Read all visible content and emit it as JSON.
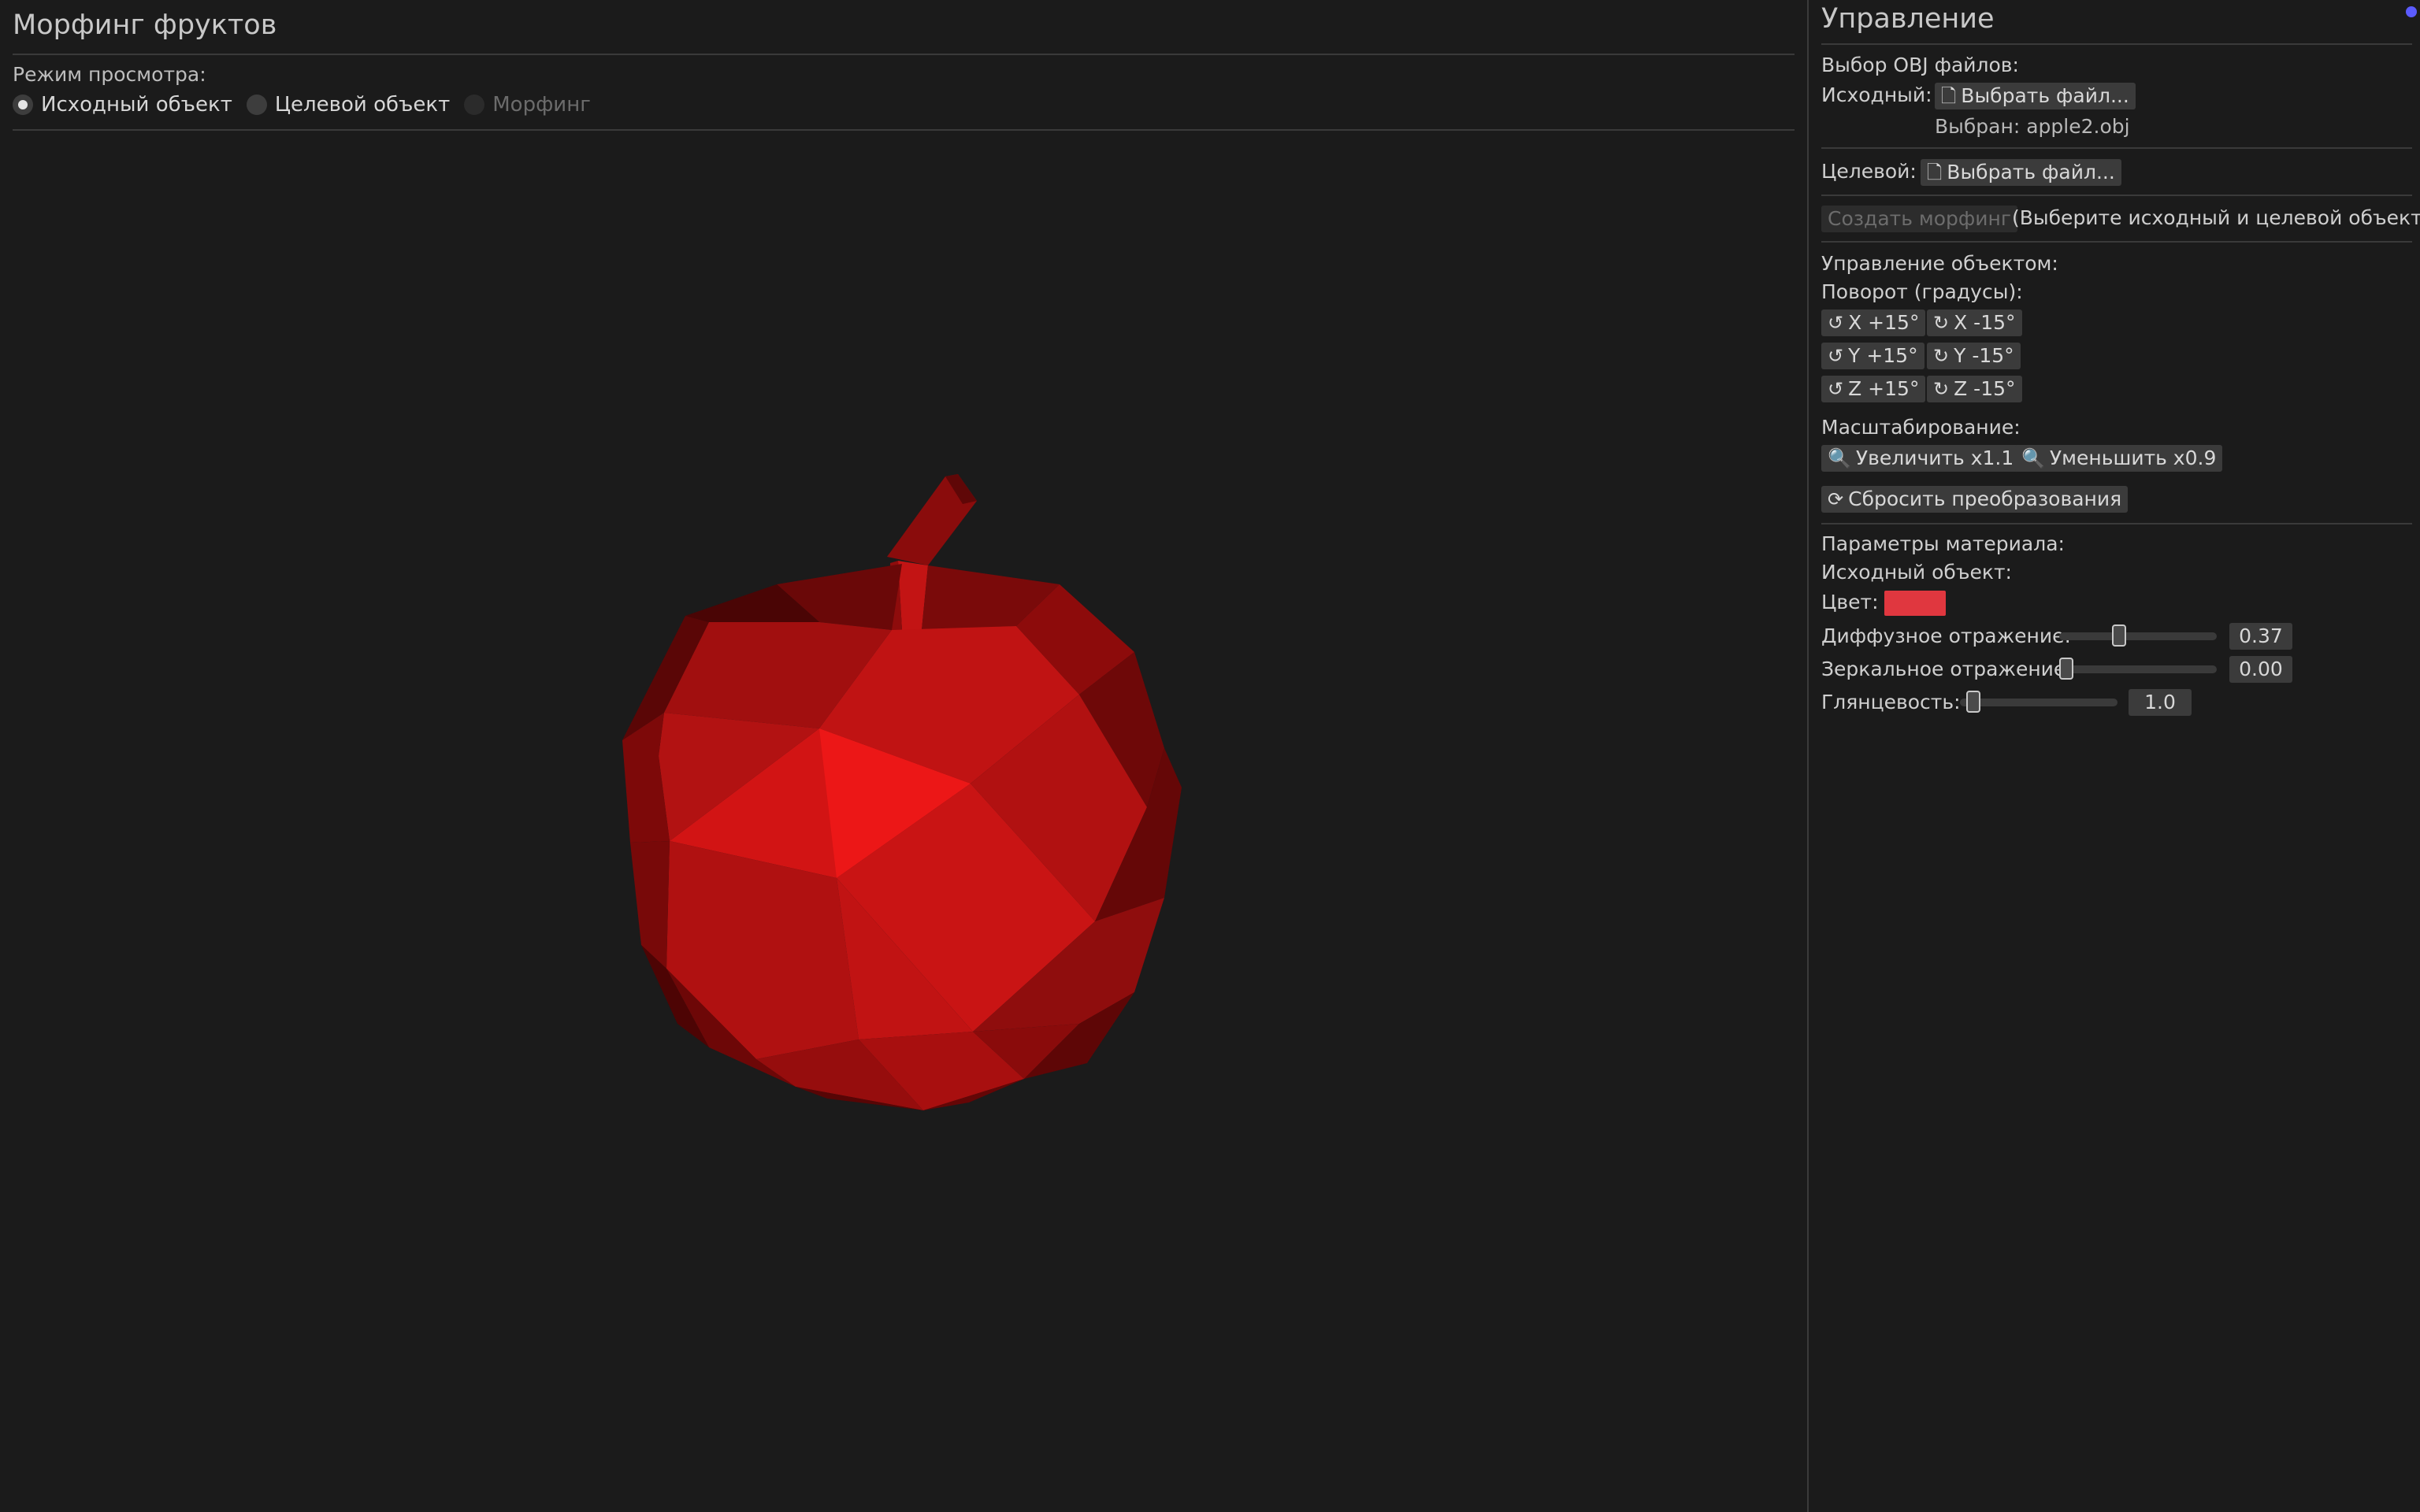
{
  "app": {
    "title": "Морфинг фруктов"
  },
  "view_mode": {
    "label": "Режим просмотра:",
    "options": [
      {
        "label": "Исходный объект",
        "selected": true,
        "enabled": true
      },
      {
        "label": "Целевой объект",
        "selected": false,
        "enabled": true
      },
      {
        "label": "Морфинг",
        "selected": false,
        "enabled": false
      }
    ]
  },
  "viewport": {
    "object": "apple-low-poly",
    "object_color": "#e0141a"
  },
  "panel": {
    "title": "Управление",
    "obj_section_label": "Выбор OBJ файлов:",
    "source_label": "Исходный:",
    "target_label": "Целевой:",
    "choose_file_label": "Выбрать файл...",
    "selected_source_text": "Выбран: apple2.obj",
    "create_morph_label": "Создать морфинг",
    "morph_hint": "(Выберите исходный и целевой объекты)",
    "object_control_label": "Управление объектом:",
    "rotation_label": "Поворот (градусы):",
    "rotation_buttons": [
      "X +15°",
      "X -15°",
      "Y +15°",
      "Y -15°",
      "Z +15°",
      "Z -15°"
    ],
    "scaling_label": "Масштабирование:",
    "zoom_in_label": "Увеличить x1.1",
    "zoom_out_label": "Уменьшить x0.9",
    "reset_label": "Сбросить преобразования",
    "material_label": "Параметры материала:",
    "source_object_label": "Исходный объект:",
    "color_label": "Цвет:",
    "color_value": "#e0373f",
    "diffuse_label": "Диффузное отражение:",
    "diffuse_value": "0.37",
    "specular_label": "Зеркальное отражение:",
    "specular_value": "0.00",
    "shininess_label": "Глянцевость:",
    "shininess_value": "1.0"
  },
  "colors": {
    "background": "#1b1b1b",
    "button": "#3b3b3b",
    "accent_dot": "#5b5bff"
  }
}
